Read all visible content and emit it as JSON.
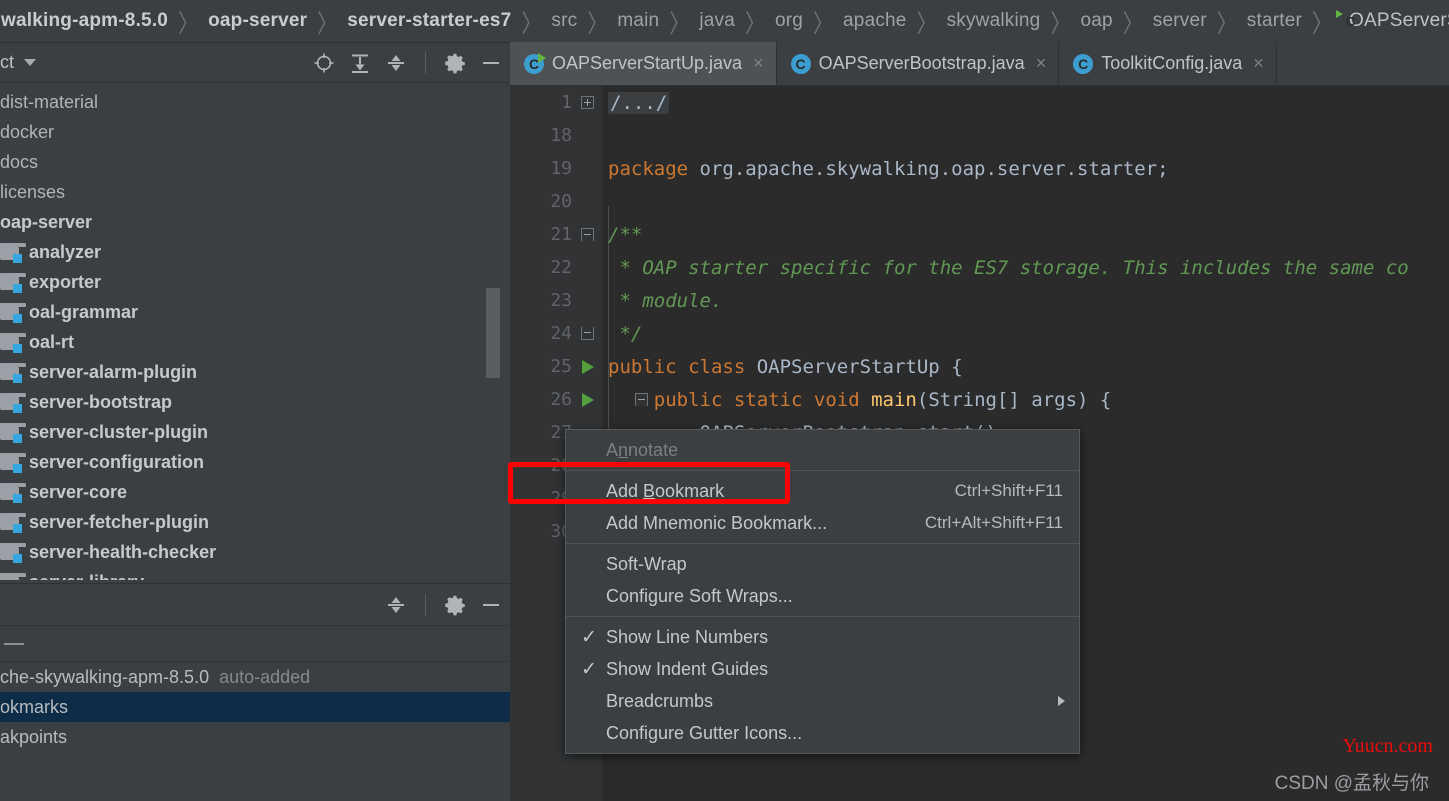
{
  "breadcrumb": {
    "items": [
      {
        "label": "walking-apm-8.5.0",
        "style": "bold"
      },
      {
        "label": "oap-server",
        "style": "bold"
      },
      {
        "label": "server-starter-es7",
        "style": "bold"
      },
      {
        "label": "src",
        "style": "plain"
      },
      {
        "label": "main",
        "style": "plain"
      },
      {
        "label": "java",
        "style": "plain"
      },
      {
        "label": "org",
        "style": "plain"
      },
      {
        "label": "apache",
        "style": "plain"
      },
      {
        "label": "skywalking",
        "style": "plain"
      },
      {
        "label": "oap",
        "style": "plain"
      },
      {
        "label": "server",
        "style": "plain"
      },
      {
        "label": "starter",
        "style": "plain"
      }
    ],
    "separator": "〉",
    "current_class": "OAPServerStartUp",
    "class_icon": "java-class-run-icon"
  },
  "project_panel": {
    "title": "ct",
    "caret_icon": "chevron-down-icon",
    "toolbar_icons": [
      {
        "name": "locate-icon",
        "title": "Select Opened File"
      },
      {
        "name": "expand-all-icon",
        "title": "Expand All"
      },
      {
        "name": "collapse-all-icon",
        "title": "Collapse All"
      },
      {
        "name": "gear-icon",
        "title": "Settings"
      },
      {
        "name": "minimize-icon",
        "title": "Hide"
      }
    ],
    "tree": [
      {
        "label": "dist-material",
        "icon": "none",
        "bold": false
      },
      {
        "label": "docker",
        "icon": "none",
        "bold": false
      },
      {
        "label": "docs",
        "icon": "none",
        "bold": false
      },
      {
        "label": "licenses",
        "icon": "none",
        "bold": false
      },
      {
        "label": "oap-server",
        "icon": "none",
        "bold": true
      },
      {
        "label": "analyzer",
        "icon": "module-folder-icon",
        "bold": true
      },
      {
        "label": "exporter",
        "icon": "module-folder-icon",
        "bold": true
      },
      {
        "label": "oal-grammar",
        "icon": "module-folder-icon",
        "bold": true
      },
      {
        "label": "oal-rt",
        "icon": "module-folder-icon",
        "bold": true
      },
      {
        "label": "server-alarm-plugin",
        "icon": "module-folder-icon",
        "bold": true
      },
      {
        "label": "server-bootstrap",
        "icon": "module-folder-icon",
        "bold": true
      },
      {
        "label": "server-cluster-plugin",
        "icon": "module-folder-icon",
        "bold": true
      },
      {
        "label": "server-configuration",
        "icon": "module-folder-icon",
        "bold": true
      },
      {
        "label": "server-core",
        "icon": "module-folder-icon",
        "bold": true
      },
      {
        "label": "server-fetcher-plugin",
        "icon": "module-folder-icon",
        "bold": true
      },
      {
        "label": "server-health-checker",
        "icon": "module-folder-icon",
        "bold": true
      },
      {
        "label": "server-library",
        "icon": "module-folder-icon",
        "bold": true
      }
    ]
  },
  "favorites_panel": {
    "toolbar_icons": [
      {
        "name": "collapse-all-icon",
        "title": "Collapse All"
      },
      {
        "name": "gear-icon",
        "title": "Settings"
      },
      {
        "name": "minimize-icon",
        "title": "Hide"
      }
    ],
    "rows": [
      {
        "label": "che-skywalking-apm-8.5.0",
        "suffix": "auto-added",
        "selected": false
      },
      {
        "label": "okmarks",
        "suffix": "",
        "selected": true
      },
      {
        "label": "akpoints",
        "suffix": "",
        "selected": false
      }
    ]
  },
  "editor": {
    "tabs": [
      {
        "label": "OAPServerStartUp.java",
        "icon": "java-class-run-icon",
        "active": true,
        "close": "×"
      },
      {
        "label": "OAPServerBootstrap.java",
        "icon": "java-class-icon",
        "active": false,
        "close": "×"
      },
      {
        "label": "ToolkitConfig.java",
        "icon": "java-class-icon",
        "active": false,
        "close": "×"
      }
    ],
    "lines": [
      {
        "num": "1",
        "gutter": "fold-plus",
        "folded": "/.../",
        "segments": []
      },
      {
        "num": "18",
        "gutter": "",
        "segments": []
      },
      {
        "num": "19",
        "gutter": "",
        "segments": [
          {
            "t": "package ",
            "c": "kw"
          },
          {
            "t": "org.apache.skywalking.oap.server.starter;",
            "c": "txt"
          }
        ]
      },
      {
        "num": "20",
        "gutter": "",
        "segments": []
      },
      {
        "num": "21",
        "gutter": "fold-start",
        "segments": [
          {
            "t": "/**",
            "c": "cmt"
          }
        ]
      },
      {
        "num": "22",
        "gutter": "",
        "segments": [
          {
            "t": " * OAP starter specific for the ES7 storage. This includes the same co",
            "c": "cmt"
          }
        ]
      },
      {
        "num": "23",
        "gutter": "",
        "segments": [
          {
            "t": " * module.",
            "c": "cmt"
          }
        ]
      },
      {
        "num": "24",
        "gutter": "fold-end",
        "segments": [
          {
            "t": " */",
            "c": "cmt"
          }
        ]
      },
      {
        "num": "25",
        "gutter": "run",
        "segments": [
          {
            "t": "public class ",
            "c": "kw"
          },
          {
            "t": "OAPServerStartUp ",
            "c": "txt"
          },
          {
            "t": "{",
            "c": "txt"
          }
        ]
      },
      {
        "num": "26",
        "gutter": "run-fold",
        "segments": [
          {
            "t": "    public static void ",
            "c": "kw"
          },
          {
            "t": "main",
            "c": "fn"
          },
          {
            "t": "(String[] args) {",
            "c": "txt"
          }
        ]
      },
      {
        "num": "27",
        "gutter": "",
        "segments": [
          {
            "t": "        OAPServerBootstrap.start();",
            "c": "txt"
          }
        ]
      },
      {
        "num": "28",
        "gutter": "",
        "segments": []
      },
      {
        "num": "29",
        "gutter": "",
        "segments": []
      },
      {
        "num": "30",
        "gutter": "",
        "segments": []
      }
    ]
  },
  "context_menu": {
    "items": [
      {
        "label": "Annotate",
        "mnemonic": "n",
        "accel": "",
        "disabled": true,
        "checked": false,
        "submenu": false
      },
      {
        "type": "separator"
      },
      {
        "label": "Add Bookmark",
        "mnemonic": "B",
        "accel": "Ctrl+Shift+F11",
        "disabled": false,
        "checked": false,
        "submenu": false,
        "highlighted": true
      },
      {
        "label": "Add Mnemonic Bookmark...",
        "mnemonic": "",
        "accel": "Ctrl+Alt+Shift+F11",
        "disabled": false,
        "checked": false,
        "submenu": false
      },
      {
        "type": "separator"
      },
      {
        "label": "Soft-Wrap",
        "mnemonic": "",
        "accel": "",
        "disabled": false,
        "checked": false,
        "submenu": false
      },
      {
        "label": "Configure Soft Wraps...",
        "mnemonic": "",
        "accel": "",
        "disabled": false,
        "checked": false,
        "submenu": false
      },
      {
        "type": "separator"
      },
      {
        "label": "Show Line Numbers",
        "mnemonic": "",
        "accel": "",
        "disabled": false,
        "checked": true,
        "submenu": false
      },
      {
        "label": "Show Indent Guides",
        "mnemonic": "",
        "accel": "",
        "disabled": false,
        "checked": true,
        "submenu": false
      },
      {
        "label": "Breadcrumbs",
        "mnemonic": "",
        "accel": "",
        "disabled": false,
        "checked": false,
        "submenu": true
      },
      {
        "label": "Configure Gutter Icons...",
        "mnemonic": "",
        "accel": "",
        "disabled": false,
        "checked": false,
        "submenu": false
      }
    ],
    "check_glyph": "✓"
  },
  "annotations": {
    "highlight_color": "#fe0000"
  },
  "watermarks": {
    "red": "Yuucn.com",
    "gray": "CSDN @孟秋与你"
  }
}
